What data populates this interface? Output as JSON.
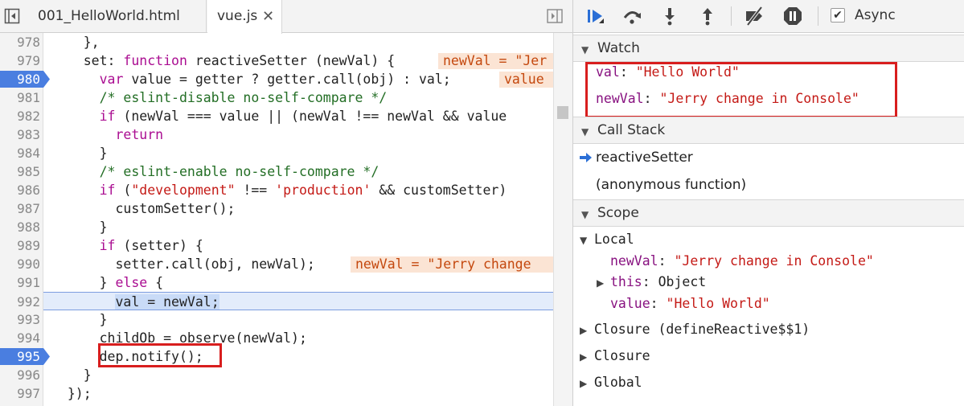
{
  "tabs": [
    {
      "label": "001_HelloWorld.html"
    },
    {
      "label": "vue.js",
      "close": "✕"
    }
  ],
  "code_lines": [
    {
      "num": "978",
      "html": "    },"
    },
    {
      "num": "979",
      "html": "    set: <span class=\"k\">function</span> reactiveSetter (newVal) {",
      "inline": "newVal = \"Jer"
    },
    {
      "num": "980",
      "html": "      <span class=\"k\">var</span> value = getter ? getter.call(obj) : val;",
      "inline": "value"
    },
    {
      "num": "981",
      "html": "      <span class=\"c\">/* eslint-disable no-self-compare */</span>"
    },
    {
      "num": "982",
      "html": "      <span class=\"k\">if</span> (newVal === value || (newVal !== newVal &amp;&amp; value"
    },
    {
      "num": "983",
      "html": "        <span class=\"k\">return</span>"
    },
    {
      "num": "984",
      "html": "      }"
    },
    {
      "num": "985",
      "html": "      <span class=\"c\">/* eslint-enable no-self-compare */</span>"
    },
    {
      "num": "986",
      "html": "      <span class=\"k\">if</span> (<span class=\"s\">\"development\"</span> !== <span class=\"s\">'production'</span> &amp;&amp; customSetter)"
    },
    {
      "num": "987",
      "html": "        customSetter();"
    },
    {
      "num": "988",
      "html": "      }"
    },
    {
      "num": "989",
      "html": "      <span class=\"k\">if</span> (setter) {"
    },
    {
      "num": "990",
      "html": "        setter.call(obj, newVal);",
      "inline": "newVal = \"Jerry change"
    },
    {
      "num": "991",
      "html": "      } <span class=\"k\">else</span> {"
    },
    {
      "num": "992",
      "html": "        <span class=\"selbg\">val = newVal;</span>"
    },
    {
      "num": "993",
      "html": "      }"
    },
    {
      "num": "994",
      "html": "      childOb = observe(newVal);"
    },
    {
      "num": "995",
      "html": "      dep.notify();"
    },
    {
      "num": "996",
      "html": "    }"
    },
    {
      "num": "997",
      "html": "  });"
    }
  ],
  "breakpoint_lines": [
    "980",
    "995"
  ],
  "current_line": "992",
  "toolbar": {
    "async_label": "Async",
    "async_checked": "✔"
  },
  "watch": {
    "title": "Watch",
    "items": [
      {
        "name": "val",
        "value": "\"Hello World\""
      },
      {
        "name": "newVal",
        "value": "\"Jerry change in Console\""
      }
    ]
  },
  "call_stack": {
    "title": "Call Stack",
    "frames": [
      "reactiveSetter",
      "(anonymous function)"
    ]
  },
  "scope": {
    "title": "Scope",
    "local_label": "Local",
    "local_items": [
      {
        "name": "newVal",
        "value": "\"Jerry change in Console\""
      },
      {
        "name": "this",
        "value": "Object"
      },
      {
        "name": "value",
        "value": "\"Hello World\""
      }
    ],
    "groups": [
      "Closure (defineReactive$$1)",
      "Closure",
      "Global"
    ]
  },
  "colors": {
    "breakpoint": "#4a7ee0",
    "highlight": "#d81e1e"
  }
}
